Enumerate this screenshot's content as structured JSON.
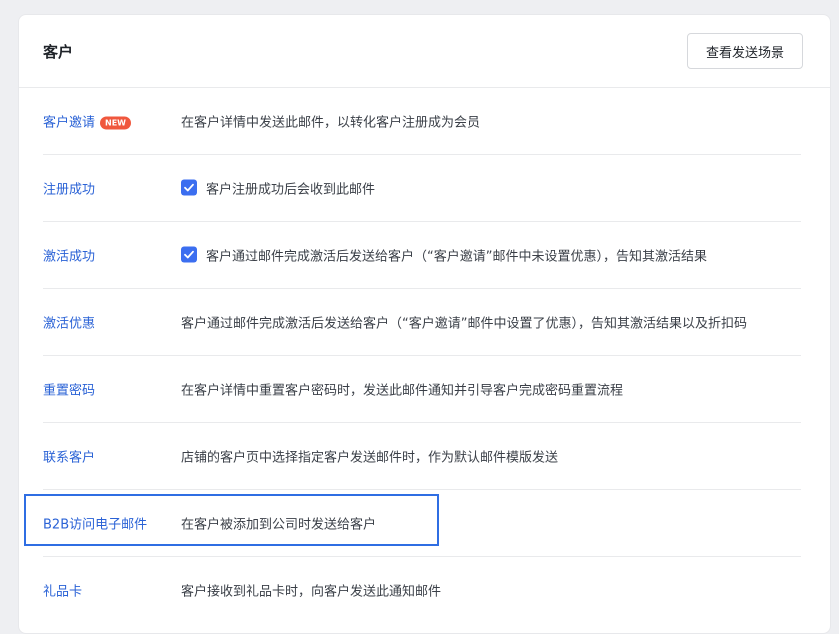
{
  "header": {
    "title": "客户",
    "view_scenes_button": "查看发送场景"
  },
  "rows": [
    {
      "name": "客户邀请",
      "badge": "NEW",
      "description": "在客户详情中发送此邮件，以转化客户注册成为会员",
      "checkbox": false
    },
    {
      "name": "注册成功",
      "description": "客户注册成功后会收到此邮件",
      "checkbox": true
    },
    {
      "name": "激活成功",
      "description": "客户通过邮件完成激活后发送给客户（“客户邀请”邮件中未设置优惠），告知其激活结果",
      "checkbox": true
    },
    {
      "name": "激活优惠",
      "description": "客户通过邮件完成激活后发送给客户（“客户邀请”邮件中设置了优惠），告知其激活结果以及折扣码",
      "checkbox": false
    },
    {
      "name": "重置密码",
      "description": "在客户详情中重置客户密码时，发送此邮件通知并引导客户完成密码重置流程",
      "checkbox": false
    },
    {
      "name": "联系客户",
      "description": "店铺的客户页中选择指定客户发送邮件时，作为默认邮件模版发送",
      "checkbox": false
    },
    {
      "name": "B2B访问电子邮件",
      "description": "在客户被添加到公司时发送给客户",
      "checkbox": false,
      "highlighted": true
    },
    {
      "name": "礼品卡",
      "description": "客户接收到礼品卡时，向客户发送此通知邮件",
      "checkbox": false
    }
  ],
  "colors": {
    "link": "#2a62d6",
    "checkbox": "#3b6ef0",
    "badge": "#f0573d",
    "highlight_border": "#2f6ee3"
  }
}
